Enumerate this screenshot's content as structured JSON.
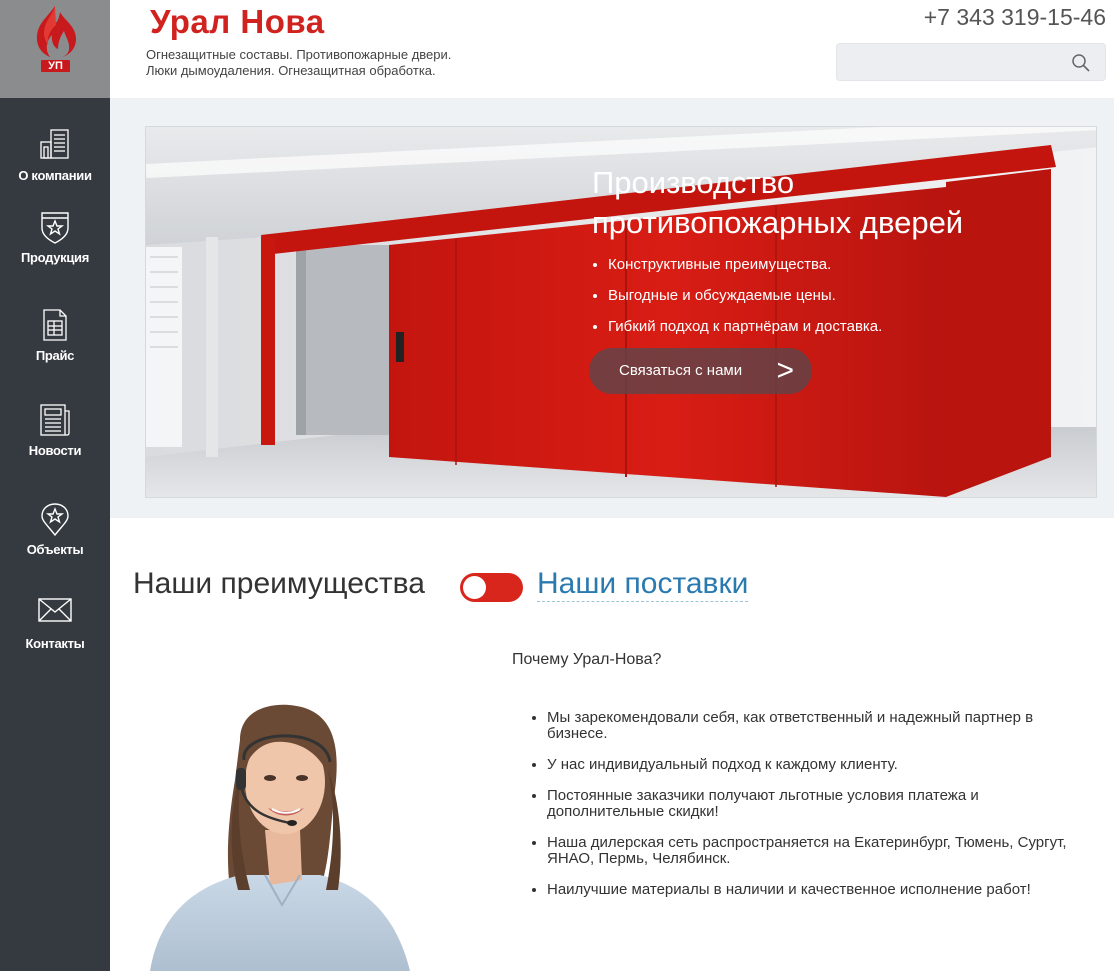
{
  "logo": {
    "text": "УП"
  },
  "header": {
    "brand": "Урал Нова",
    "tagline_line1": "Огнезащитные составы. Противопожарные двери.",
    "tagline_line2": "Люки дымоудаления. Огнезащитная обработка.",
    "phone": "+7 343 319-15-46",
    "search_value": ""
  },
  "sidebar": {
    "items": [
      {
        "label": "О компании",
        "icon": "building-icon"
      },
      {
        "label": "Продукция",
        "icon": "shield-star-icon"
      },
      {
        "label": "Прайс",
        "icon": "price-document-icon"
      },
      {
        "label": "Новости",
        "icon": "newspaper-icon"
      },
      {
        "label": "Объекты",
        "icon": "map-pin-star-icon"
      },
      {
        "label": "Контакты",
        "icon": "envelope-icon"
      }
    ]
  },
  "banner": {
    "title_line1": "Производство",
    "title_line2": "противопожарных дверей",
    "bullets": [
      "Конструктивные преимущества.",
      "Выгодные и обсуждаемые цены.",
      "Гибкий подход к партнёрам и доставка."
    ],
    "cta_label": "Связаться с нами",
    "cta_arrow": ">"
  },
  "sections": {
    "left_title": "Наши преимущества",
    "right_title": "Наши поставки",
    "toggle_state": "off"
  },
  "advantages": {
    "heading": "Почему Урал-Нова?",
    "items": [
      "Мы зарекомендовали себя, как ответственный и надежный партнер в бизнесе.",
      "У нас индивидуальный подход к каждому клиенту.",
      "Постоянные заказчики получают льготные условия платежа и дополнительные скидки!",
      "Наша дилерская сеть распространяется на Екатеринбург, Тюмень, Сургут, ЯНАО, Пермь, Челябинск.",
      "Наилучшие материалы в наличии и качественное исполнение работ!"
    ]
  },
  "colors": {
    "brand_red": "#d0231f",
    "sidebar_bg": "#343a40",
    "link_blue": "#2a7ab0"
  }
}
